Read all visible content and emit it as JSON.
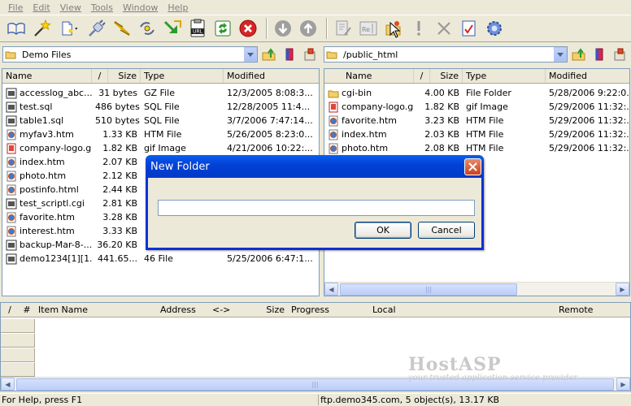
{
  "menu": [
    "File",
    "Edit",
    "View",
    "Tools",
    "Window",
    "Help"
  ],
  "toolbar": {
    "icons": [
      "book-icon",
      "wizard-icon",
      "new-file-icon",
      "connect-icon",
      "disconnect-icon",
      "refresh-connection-icon",
      "download-arrow-icon",
      "url-icon",
      "sync-icon",
      "stop-icon",
      "down-circle-icon",
      "up-circle-icon",
      "edit-icon",
      "rename-icon",
      "new-folder-icon",
      "exclamation-icon",
      "delete-icon",
      "properties-icon",
      "settings-icon"
    ]
  },
  "left_pane": {
    "path": "Demo Files",
    "columns": {
      "name": "Name",
      "sort": "/",
      "size": "Size",
      "type": "Type",
      "modified": "Modified"
    },
    "files": [
      {
        "name": "accesslog_abc...",
        "size": "31 bytes",
        "type": "GZ File",
        "modified": "12/3/2005 8:08:3...",
        "icon": "gz"
      },
      {
        "name": "test.sql",
        "size": "486 bytes",
        "type": "SQL File",
        "modified": "12/28/2005 11:4...",
        "icon": "sql"
      },
      {
        "name": "table1.sql",
        "size": "510 bytes",
        "type": "SQL File",
        "modified": "3/7/2006 7:47:14...",
        "icon": "sql"
      },
      {
        "name": "myfav3.htm",
        "size": "1.33 KB",
        "type": "HTM File",
        "modified": "5/26/2005 8:23:0...",
        "icon": "htm"
      },
      {
        "name": "company-logo.gif",
        "size": "1.82 KB",
        "type": "gif Image",
        "modified": "4/21/2006 10:22:...",
        "icon": "gif"
      },
      {
        "name": "index.htm",
        "size": "2.07 KB",
        "type": "",
        "modified": "",
        "icon": "htm"
      },
      {
        "name": "photo.htm",
        "size": "2.12 KB",
        "type": "",
        "modified": "",
        "icon": "htm"
      },
      {
        "name": "postinfo.html",
        "size": "2.44 KB",
        "type": "",
        "modified": "",
        "icon": "htm"
      },
      {
        "name": "test_scriptl.cgi",
        "size": "2.81 KB",
        "type": "",
        "modified": "",
        "icon": "cgi"
      },
      {
        "name": "favorite.htm",
        "size": "3.28 KB",
        "type": "",
        "modified": "",
        "icon": "htm"
      },
      {
        "name": "interest.htm",
        "size": "3.33 KB",
        "type": "",
        "modified": "",
        "icon": "htm"
      },
      {
        "name": "backup-Mar-8-...",
        "size": "36.20 KB",
        "type": "",
        "modified": "",
        "icon": "gz"
      },
      {
        "name": "demo1234[1][1...",
        "size": "441.65...",
        "type": "46 File",
        "modified": "5/25/2006 6:47:1...",
        "icon": "gz"
      }
    ]
  },
  "right_pane": {
    "path": "/public_html",
    "columns": {
      "name": "Name",
      "sort": "/",
      "size": "Size",
      "type": "Type",
      "modified": "Modified"
    },
    "files": [
      {
        "name": "cgi-bin",
        "size": "4.00 KB",
        "type": "File Folder",
        "modified": "5/28/2006 9:22:0...",
        "icon": "folder"
      },
      {
        "name": "company-logo.gif",
        "size": "1.82 KB",
        "type": "gif Image",
        "modified": "5/29/2006 11:32:...",
        "icon": "gif"
      },
      {
        "name": "favorite.htm",
        "size": "3.23 KB",
        "type": "HTM File",
        "modified": "5/29/2006 11:32:...",
        "icon": "htm"
      },
      {
        "name": "index.htm",
        "size": "2.03 KB",
        "type": "HTM File",
        "modified": "5/29/2006 11:32:...",
        "icon": "htm"
      },
      {
        "name": "photo.htm",
        "size": "2.08 KB",
        "type": "HTM File",
        "modified": "5/29/2006 11:32:...",
        "icon": "htm"
      }
    ]
  },
  "dialog": {
    "title": "New Folder",
    "input_value": "",
    "ok_label": "OK",
    "cancel_label": "Cancel"
  },
  "queue": {
    "columns": [
      "/",
      "#",
      "Item Name",
      "Address",
      "<->",
      "Size",
      "Progress",
      "Local",
      "Remote"
    ]
  },
  "watermark": {
    "brand": "HostASP",
    "tagline": "your trusted application service provider"
  },
  "status": {
    "left": "For Help, press F1",
    "right": "ftp.demo345.com, 5 object(s), 13.17 KB"
  }
}
